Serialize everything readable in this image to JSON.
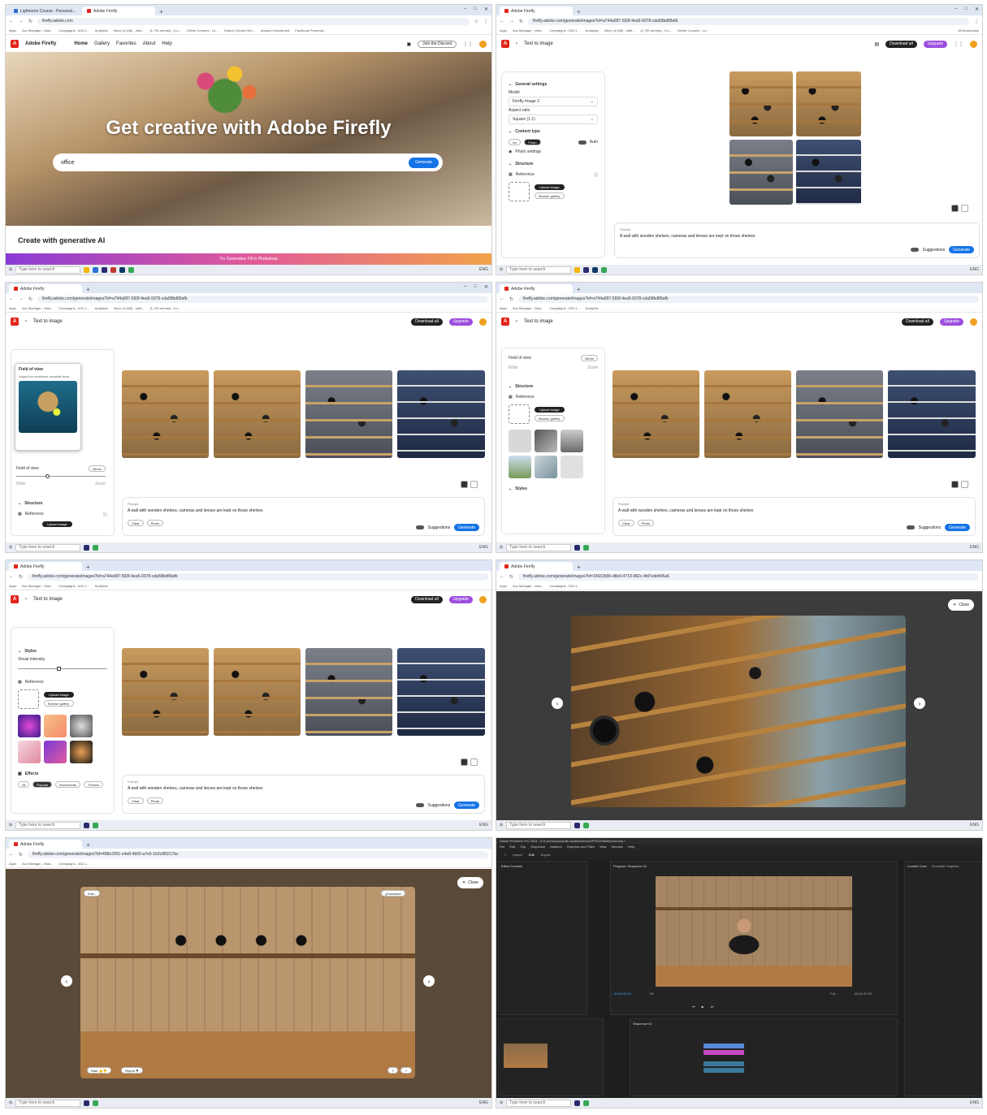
{
  "taskbar": {
    "search_placeholder": "Type here to search",
    "lang": "ENG"
  },
  "bookmarks": [
    "Apps",
    "Acc Manager - Man...",
    "Campaigns - 632-1...",
    "Analytics",
    "Inbox (4,946) - kalit...",
    "(1,730 unread) - b.s...",
    "Online Courses - Le...",
    "Ontent | Kindle Dire...",
    "Amazon Dashboard",
    "Facebook Personal...",
    "All Bookmarks"
  ],
  "panel1": {
    "tabs": [
      "Lightroom Course - Personal...",
      "Adobe Firefly"
    ],
    "url": "firefly.adobe.com",
    "brand": "Adobe Firefly",
    "nav": [
      "Home",
      "Gallery",
      "Favorites",
      "About",
      "Help"
    ],
    "discord": "Join the Discord",
    "hero_title": "Get creative with Adobe Firefly",
    "search_value": "office",
    "generate": "Generate",
    "section_title": "Create with generative AI",
    "promo": "Try Generative Fill in Photoshop"
  },
  "editor": {
    "tab": "Adobe Firefly",
    "url": "firefly.adobe.com/generate/images?id=a744a997-593f-4ea5-9378-cda58bd89afb",
    "back": "Text to image",
    "download_all": "Download all",
    "upgrade": "Upgrade",
    "general_settings": "General settings",
    "model_label": "Model",
    "model_value": "Firefly Image 2",
    "aspect_label": "Aspect ratio",
    "aspect_value": "Square (1:1)",
    "content_type": "Content type",
    "art": "Art",
    "photo": "Photo",
    "auto": "Auto",
    "photo_settings": "Photo settings",
    "structure": "Structure",
    "reference": "Reference",
    "upload_image": "Upload image",
    "browse_gallery": "Browse gallery",
    "prompt_label": "Prompt",
    "prompt": "A wall with wooden shelves, cameras and lenses are kept on those shelves",
    "suggestions": "Suggestions",
    "generate": "Generate",
    "clear": "Clear",
    "photo_chip": "Photo",
    "fov_title": "Field of view",
    "fov_desc": "Adjust the maximum viewable area.",
    "fov_label": "Field of view",
    "fov_value": "35mm",
    "wide": "Wide",
    "zoom": "Zoom",
    "styles": "Styles",
    "visual_intensity": "Visual intensity",
    "effects": "Effects",
    "effect_tabs": [
      "All",
      "Popular",
      "Movements",
      "Themes"
    ]
  },
  "panel6": {
    "url": "firefly.adobe.com/generate/images?id=15632b06-d8e0-4719-982c-4fd7edd496a6",
    "close": "Close"
  },
  "panel7": {
    "url": "firefly.adobe.com/generate/images?id=498e2901-e4a8-4b50-a7e0-1b3c8f3217bc",
    "edit": "Edit",
    "download": "Download",
    "rate": "Rate",
    "report": "Report",
    "close": "Close"
  },
  "premiere": {
    "title": "Adobe Premiere Pro 2023 - D:\\Courses\\youtube-studio\\videos\\OFFICE\\firefly\\new-key *",
    "menu": [
      "File",
      "Edit",
      "Clip",
      "Sequence",
      "Markers",
      "Graphics and Titles",
      "View",
      "Window",
      "Help"
    ],
    "workspaces": [
      "Import",
      "Edit",
      "Export"
    ],
    "effect_controls": "Effect Controls",
    "program": "Program: Sequence 01",
    "sequence": "Sequence 01",
    "timecode": "00:00:20:01",
    "duration": "00:01:22:20",
    "fit": "Fit",
    "full": "Full",
    "lumetri": "Lumetri Color",
    "essential": "Essential Graphics"
  },
  "colors": {
    "adobe_red": "#e1251b",
    "generate_blue": "#1473e6",
    "upgrade_purple": "#9b4dde"
  }
}
